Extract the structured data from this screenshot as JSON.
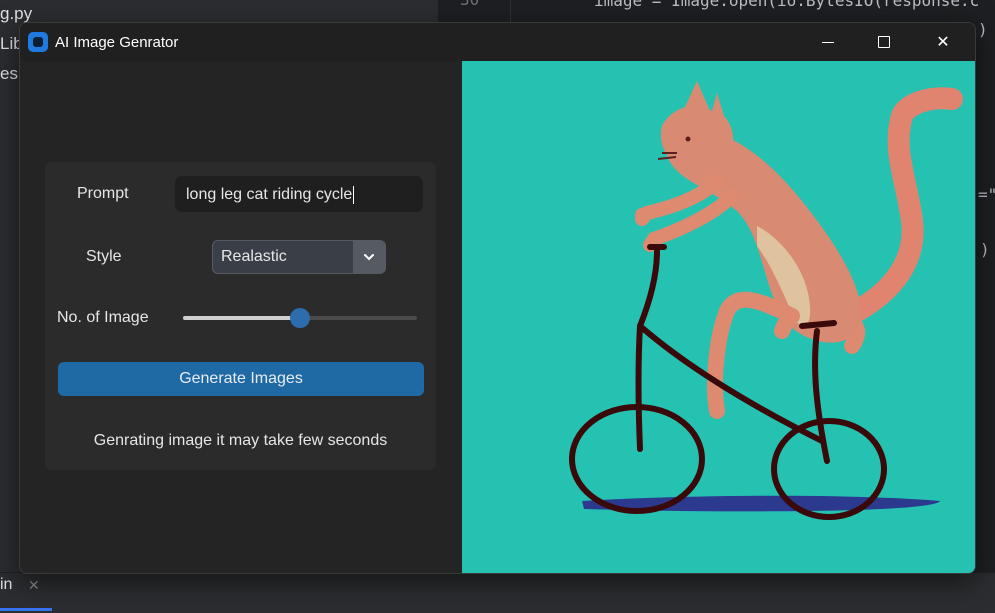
{
  "ide": {
    "sidebar_files": [
      "g.py",
      "Lib",
      "es a"
    ],
    "line_number": "30",
    "code_lines": [
      "image = Image.open(io.BytesIO(response.c",
      ")",
      "=\"",
      ")"
    ],
    "bottom_tab": "in"
  },
  "window": {
    "title": "AI Image Genrator",
    "controls": {
      "minimize_icon": "minimize-icon",
      "maximize_icon": "maximize-icon",
      "close_icon": "close-icon",
      "close_glyph": "✕"
    }
  },
  "form": {
    "prompt_label": "Prompt",
    "prompt_value": "long leg cat riding cycle",
    "style_label": "Style",
    "style_value": "Realastic",
    "num_label": "No. of Image",
    "num_slider_fraction": 0.5,
    "generate_label": "Generate Images",
    "status_text": "Genrating image it may take few seconds"
  },
  "colors": {
    "accent": "#1f6aa5",
    "image_background": "#25c2b2",
    "window_bg": "#242424",
    "card_bg": "#2b2b2b"
  }
}
